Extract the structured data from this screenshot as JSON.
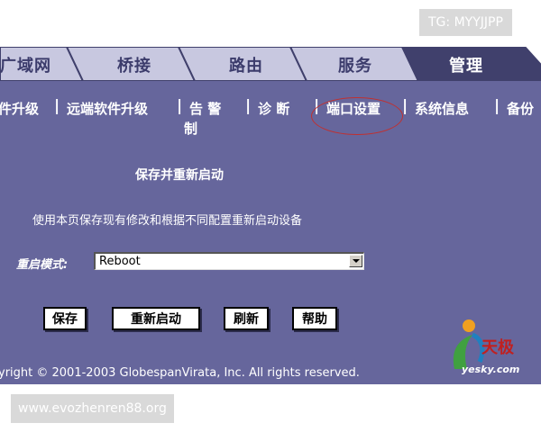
{
  "watermarks": {
    "top_right": "TG: MYYJJPP",
    "bottom_left": "www.evozhenren88.org"
  },
  "tabs": [
    {
      "label": "广域网",
      "active": false
    },
    {
      "label": "桥接",
      "active": false
    },
    {
      "label": "路由",
      "active": false
    },
    {
      "label": "服务",
      "active": false
    },
    {
      "label": "管理",
      "active": true
    }
  ],
  "sub_nav": {
    "items": [
      {
        "label": "件升级"
      },
      {
        "label": "远端软件升级"
      },
      {
        "label": "告 警"
      },
      {
        "label": "制"
      },
      {
        "label": "诊 断"
      },
      {
        "label": "端口设置",
        "highlighted": true
      },
      {
        "label": "系统信息"
      },
      {
        "label": "备份"
      }
    ],
    "separator": "|"
  },
  "main": {
    "title": "保存并重新启动",
    "description": "使用本页保存现有修改和根据不同配置重新启动设备",
    "restart_mode_label": "重启模式:",
    "restart_mode_value": "Reboot"
  },
  "buttons": {
    "save": "保存",
    "restart": "重新启动",
    "refresh": "刷新",
    "help": "帮助"
  },
  "footer": {
    "copyright": "yright © 2001-2003 GlobespanVirata, Inc. All rights reserved."
  },
  "logo": {
    "name": "天极",
    "site": "yesky.com"
  },
  "colors": {
    "panel": "#66669c",
    "tab_active": "#40406c",
    "tab_inactive": "#c8c8e0",
    "highlight_circle": "#c03030"
  }
}
